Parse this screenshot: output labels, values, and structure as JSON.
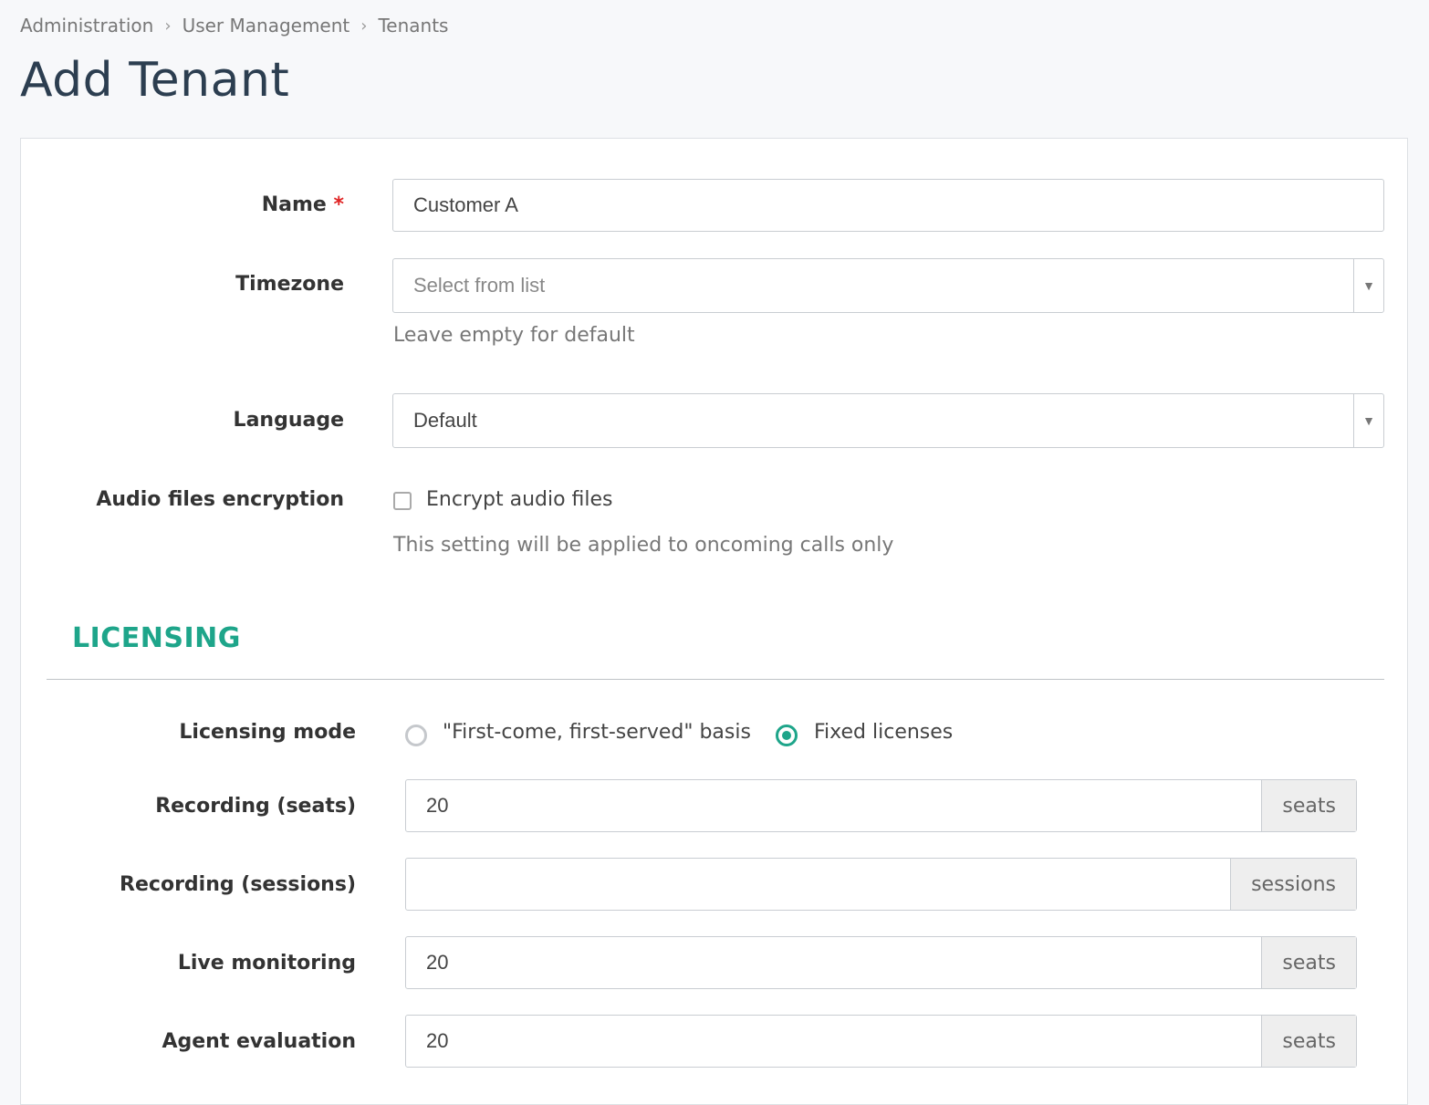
{
  "breadcrumb": [
    "Administration",
    "User Management",
    "Tenants"
  ],
  "page_title": "Add Tenant",
  "form": {
    "name": {
      "label": "Name",
      "required_mark": "*",
      "value": "Customer A"
    },
    "timezone": {
      "label": "Timezone",
      "placeholder": "Select from list",
      "help": "Leave empty for default"
    },
    "language": {
      "label": "Language",
      "value": "Default"
    },
    "audio_encryption": {
      "label": "Audio files encryption",
      "checkbox_label": "Encrypt audio files",
      "checked": false,
      "help": "This setting will be applied to oncoming calls only"
    }
  },
  "licensing": {
    "section_title": "LICENSING",
    "mode": {
      "label": "Licensing mode",
      "options": [
        "\"First-come, first-served\" basis",
        "Fixed licenses"
      ],
      "selected": "Fixed licenses"
    },
    "recording_seats": {
      "label": "Recording (seats)",
      "value": "20",
      "unit": "seats"
    },
    "recording_sessions": {
      "label": "Recording (sessions)",
      "value": "",
      "unit": "sessions"
    },
    "live_monitoring": {
      "label": "Live monitoring",
      "value": "20",
      "unit": "seats"
    },
    "agent_evaluation": {
      "label": "Agent evaluation",
      "value": "20",
      "unit": "seats"
    }
  },
  "colors": {
    "accent": "#1ea58a",
    "required": "#e02424",
    "title": "#2c3e50"
  },
  "icons": {
    "breadcrumb_separator": "chevron-right-icon",
    "select_arrow": "caret-down-icon"
  }
}
